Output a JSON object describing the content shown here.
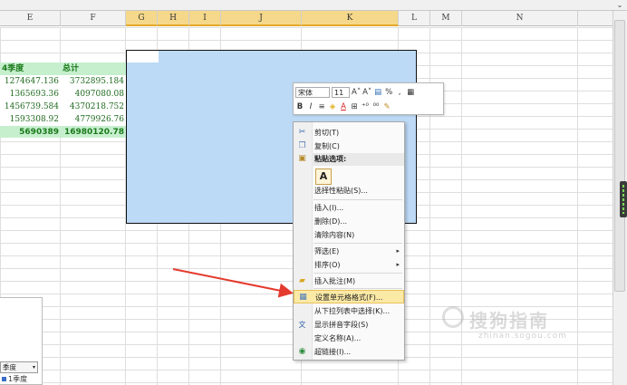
{
  "scroll": {
    "up_arrow": "⌄"
  },
  "columns": [
    {
      "label": "E",
      "w": 67,
      "sel": false
    },
    {
      "label": "F",
      "w": 72,
      "sel": false
    },
    {
      "label": "G",
      "w": 35,
      "sel": true
    },
    {
      "label": "H",
      "w": 35,
      "sel": true
    },
    {
      "label": "I",
      "w": 35,
      "sel": true
    },
    {
      "label": "J",
      "w": 89,
      "sel": true
    },
    {
      "label": "K",
      "w": 107,
      "sel": true
    },
    {
      "label": "L",
      "w": 35,
      "sel": false
    },
    {
      "label": "M",
      "w": 35,
      "sel": false
    },
    {
      "label": "N",
      "w": 128,
      "sel": false
    }
  ],
  "table": {
    "headers": [
      "4季度",
      "总计"
    ],
    "rows": [
      [
        "1274647.136",
        "3732895.184"
      ],
      [
        "1365693.36",
        "4097080.08"
      ],
      [
        "1456739.584",
        "4370218.752"
      ],
      [
        "1593308.92",
        "4779926.76"
      ]
    ],
    "totals": [
      "5690389",
      "16980120.78"
    ]
  },
  "mini_toolbar": {
    "font": "宋体",
    "size": "11",
    "row1": [
      "A˄",
      "A˅",
      "▤",
      "%",
      ",",
      "▦"
    ],
    "row2": [
      "B",
      "I",
      "≡",
      "◈",
      "A",
      "⊞",
      "⁺⁰",
      "⁰⁰",
      "✎"
    ]
  },
  "context_menu": {
    "cut": "剪切(T)",
    "copy": "复制(C)",
    "paste_options": "粘贴选项:",
    "paste_a": "A",
    "paste_special": "选择性粘贴(S)...",
    "insert": "插入(I)...",
    "delete": "删除(D)...",
    "clear": "清除内容(N)",
    "filter": "筛选(E)",
    "sort": "排序(O)",
    "insert_comment": "插入批注(M)",
    "format_cells": "设置单元格格式(F)...",
    "pick_list": "从下拉列表中选择(K)...",
    "phonetic": "显示拼音字段(S)",
    "define_name": "定义名称(A)...",
    "hyperlink": "超链接(I)...",
    "submenu_arrow": "▸"
  },
  "pivot": {
    "filter_label": "季度",
    "dropdown": "▾",
    "item": "1季度"
  },
  "watermark": {
    "main": "搜狗指南",
    "sub": "zhinan.sogou.com"
  },
  "colors": {
    "selection": "#bcd9f5",
    "green_fill": "#c6efce",
    "green_text": "#1a7a1a",
    "arrow": "#e53a2e",
    "highlight": "#fbe9a6"
  }
}
